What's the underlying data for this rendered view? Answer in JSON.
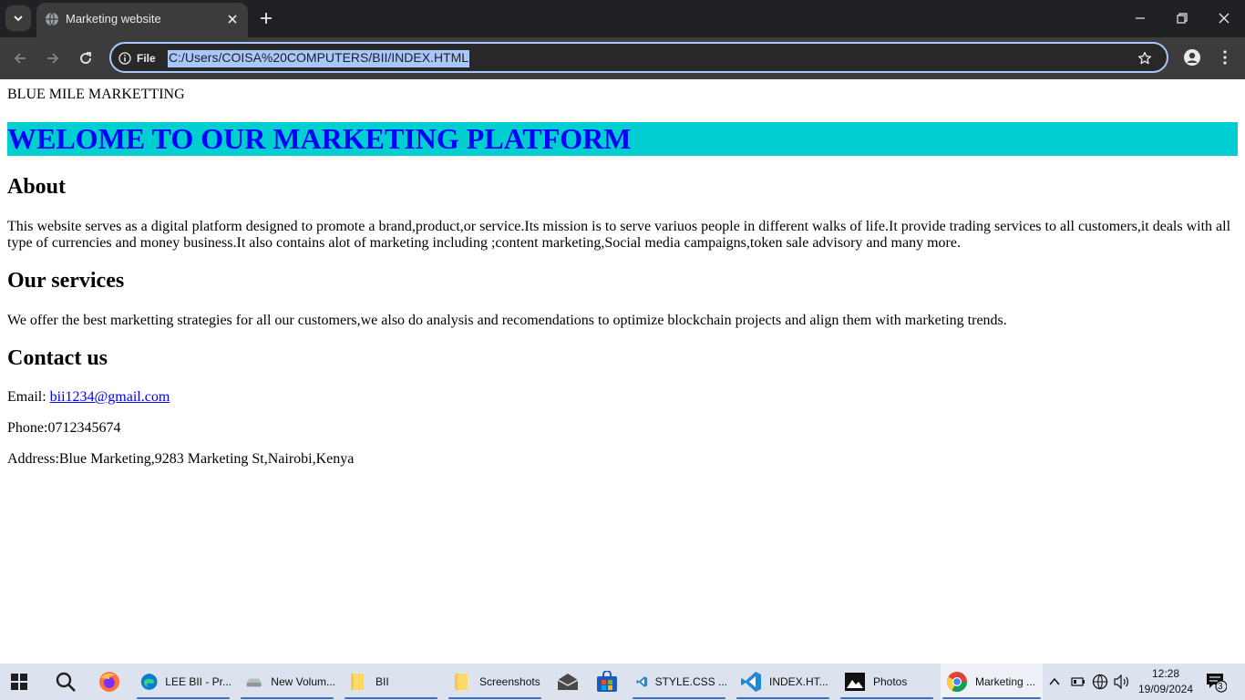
{
  "browser": {
    "tab_title": "Marketing website",
    "site_info_label": "File",
    "url": "C:/Users/COISA%20COMPUTERS/BII/INDEX.HTML"
  },
  "page": {
    "brand": "BLUE MILE MARKETTING",
    "hero_heading": "WELOME TO OUR MARKETING PLATFORM",
    "about_heading": "About",
    "about_text": "This website serves as a digital platform designed to promote a brand,product,or service.Its mission is to serve variuos people in different walks of life.It provide trading services to all customers,it deals with all type of currencies and money business.It also contains alot of marketing including ;content marketing,Social media campaigns,token sale advisory and many more.",
    "services_heading": "Our services",
    "services_text": "We offer the best marketting strategies for all our customers,we also do analysis and recomendations to optimize blockchain projects and align them with marketing trends.",
    "contact_heading": "Contact us",
    "email_label": "Email: ",
    "email": "bii1234@gmail.com",
    "phone": "Phone:0712345674",
    "address": "Address:Blue Marketing,9283 Marketing St,Nairobi,Kenya"
  },
  "taskbar": {
    "apps": [
      {
        "label": "",
        "icon": "firefox-icon"
      },
      {
        "label": "LEE BII - Pr...",
        "icon": "edge-icon"
      },
      {
        "label": "New Volum...",
        "icon": "drive-icon"
      },
      {
        "label": "BII",
        "icon": "folder-icon"
      },
      {
        "label": "Screenshots",
        "icon": "folder-icon"
      },
      {
        "label": "",
        "icon": "mail-icon"
      },
      {
        "label": "",
        "icon": "store-icon"
      },
      {
        "label": "STYLE.CSS ...",
        "icon": "vscode-icon"
      },
      {
        "label": "INDEX.HT...",
        "icon": "vscode-icon"
      },
      {
        "label": "Photos",
        "icon": "photos-icon"
      },
      {
        "label": "Marketing ...",
        "icon": "chrome-icon"
      }
    ],
    "time": "12:28",
    "date": "19/09/2024",
    "notification_count": "3"
  },
  "colors": {
    "hero_bg": "#00ced1",
    "hero_text": "#0000ff",
    "url_highlight": "#a8c7fa",
    "chrome_dark": "#202124"
  }
}
